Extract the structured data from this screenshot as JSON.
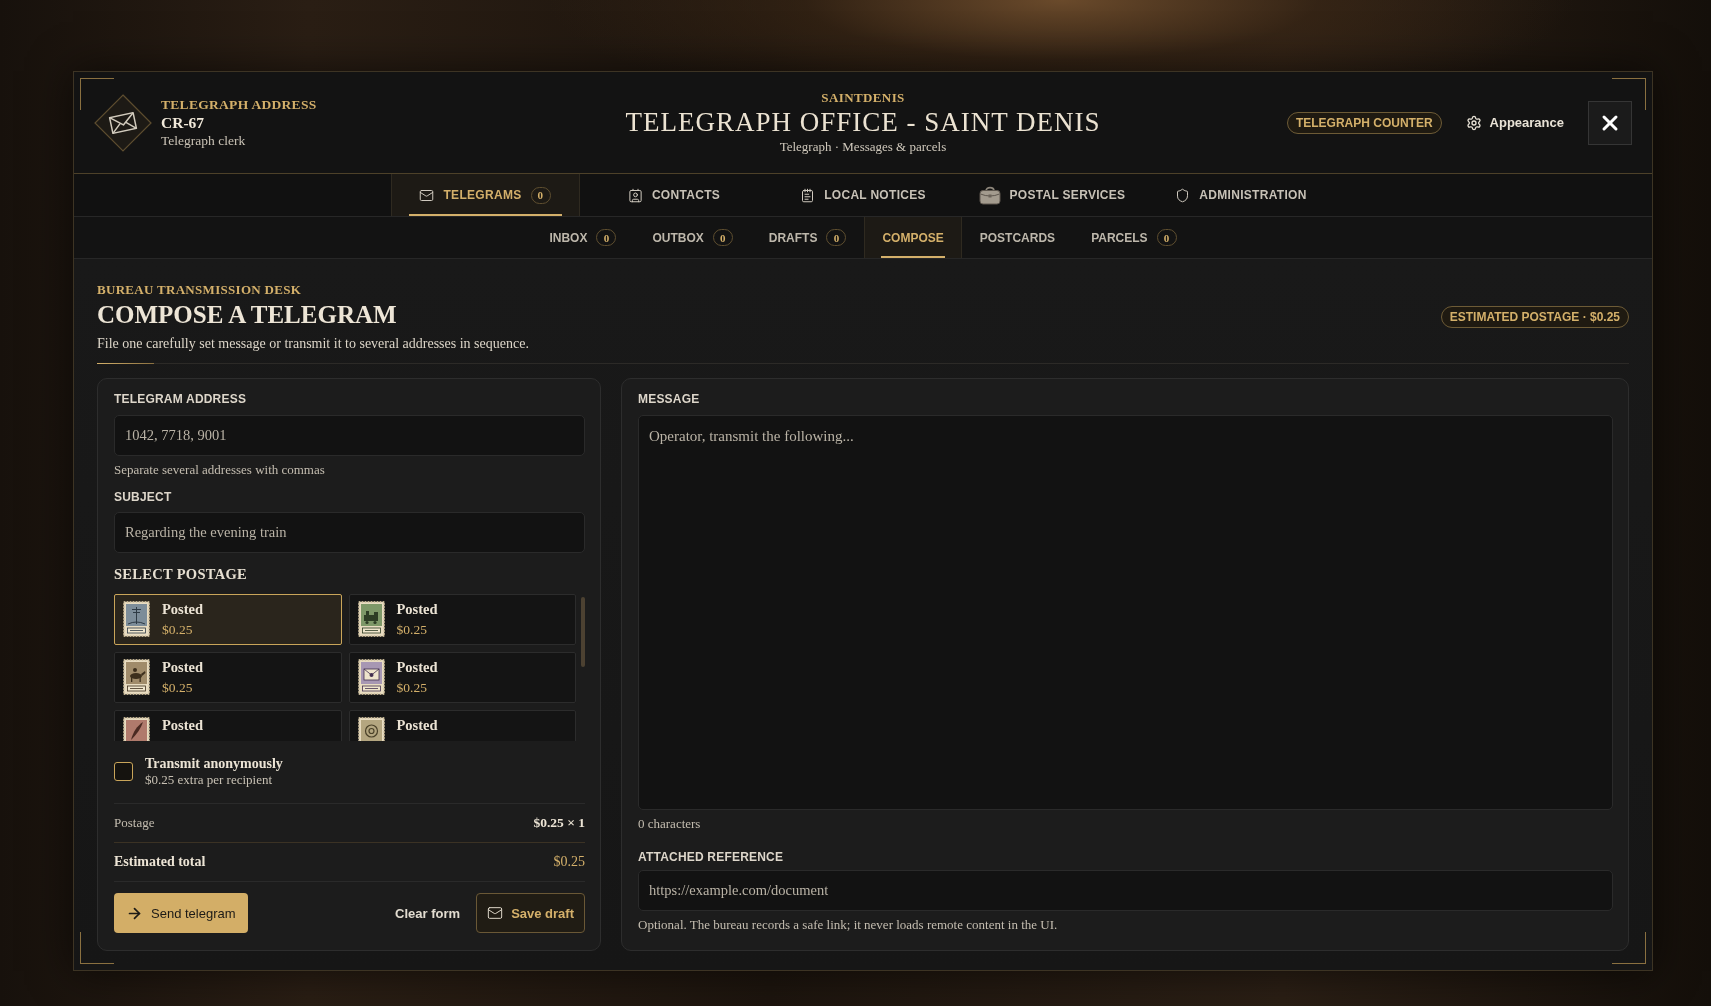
{
  "header": {
    "address_label": "TELEGRAPH ADDRESS",
    "address": "CR-67",
    "role": "Telegraph clerk",
    "location": "SAINTDENIS",
    "title": "TELEGRAPH OFFICE - SAINT DENIS",
    "subtitle": "Telegraph · Messages & parcels",
    "badge": "TELEGRAPH COUNTER",
    "appearance": "Appearance"
  },
  "tabs": [
    {
      "label": "TELEGRAMS",
      "count": "0",
      "selected": true
    },
    {
      "label": "CONTACTS",
      "selected": false
    },
    {
      "label": "LOCAL NOTICES",
      "selected": false
    },
    {
      "label": "POSTAL SERVICES",
      "selected": false
    },
    {
      "label": "ADMINISTRATION",
      "selected": false
    }
  ],
  "subtabs": [
    {
      "label": "INBOX",
      "count": "0",
      "selected": false
    },
    {
      "label": "OUTBOX",
      "count": "0",
      "selected": false
    },
    {
      "label": "DRAFTS",
      "count": "0",
      "selected": false
    },
    {
      "label": "COMPOSE",
      "selected": true
    },
    {
      "label": "POSTCARDS",
      "selected": false
    },
    {
      "label": "PARCELS",
      "count": "0",
      "selected": false
    }
  ],
  "section": {
    "eyebrow": "BUREAU TRANSMISSION DESK",
    "title": "COMPOSE A TELEGRAM",
    "description": "File one carefully set message or transmit it to several addresses in sequence.",
    "postage_badge": "ESTIMATED POSTAGE · $0.25"
  },
  "form": {
    "address": {
      "label": "TELEGRAM ADDRESS",
      "placeholder": "1042, 7718, 9001",
      "hint": "Separate several addresses with commas"
    },
    "subject": {
      "label": "SUBJECT",
      "placeholder": "Regarding the evening train"
    },
    "postage": {
      "label": "SELECT POSTAGE",
      "stamps": [
        {
          "name": "Posted",
          "price": "$0.25",
          "selected": true
        },
        {
          "name": "Posted",
          "price": "$0.25",
          "selected": false
        },
        {
          "name": "Posted",
          "price": "$0.25",
          "selected": false
        },
        {
          "name": "Posted",
          "price": "$0.25",
          "selected": false
        },
        {
          "name": "Posted",
          "selected": false
        },
        {
          "name": "Posted",
          "selected": false
        }
      ]
    },
    "anonymous": {
      "label": "Transmit anonymously",
      "note": "$0.25 extra per recipient",
      "checked": false
    },
    "summary": [
      {
        "kind": "line",
        "label": "Postage",
        "value": "$0.25 × 1"
      },
      {
        "kind": "total",
        "label": "Estimated total",
        "value": "$0.25"
      }
    ],
    "buttons": [
      {
        "kind": "primary",
        "label": "Send telegram"
      },
      {
        "kind": "plain",
        "label": "Clear form"
      },
      {
        "kind": "outline",
        "label": "Save draft"
      }
    ]
  },
  "message": {
    "label": "MESSAGE",
    "placeholder": "Operator, transmit the following...",
    "count": "0 characters",
    "reference": {
      "label": "ATTACHED REFERENCE",
      "placeholder": "https://example.com/document",
      "hint": "Optional. The bureau records a safe link; it never loads remote content in the UI."
    }
  }
}
